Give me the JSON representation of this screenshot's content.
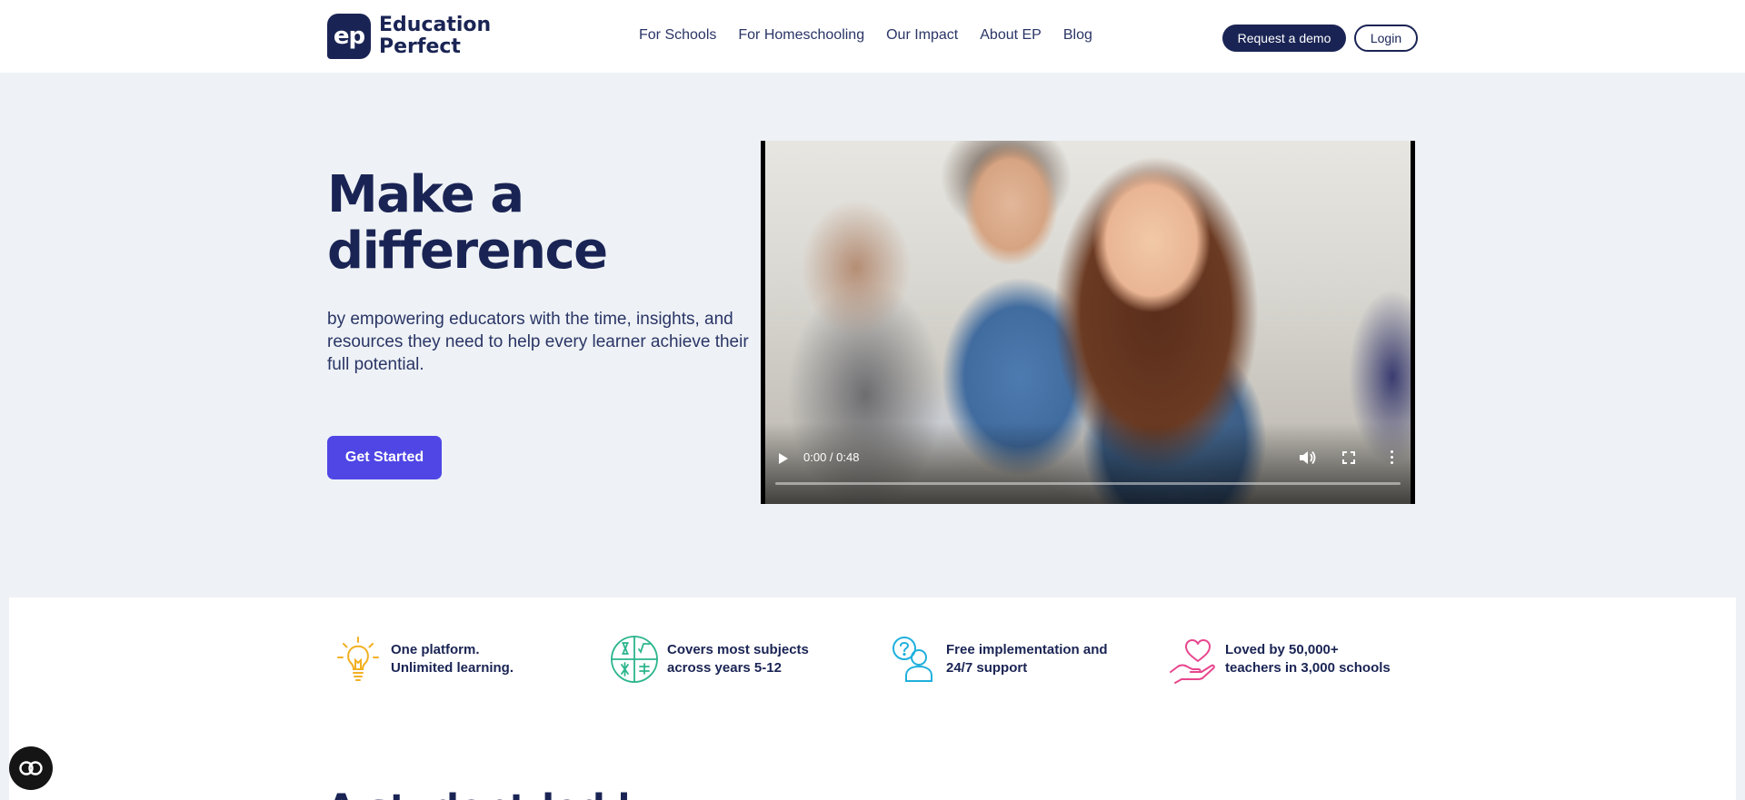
{
  "header": {
    "logo": {
      "mark": "ep",
      "line1": "Education",
      "line2": "Perfect"
    },
    "nav": [
      {
        "label": "For Schools"
      },
      {
        "label": "For Homeschooling"
      },
      {
        "label": "Our Impact"
      },
      {
        "label": "About EP"
      },
      {
        "label": "Blog"
      }
    ],
    "demo_label": "Request a demo",
    "login_label": "Login"
  },
  "hero": {
    "title_line1": "Make a",
    "title_line2": "difference",
    "subtitle": "by empowering educators with the time, insights, and resources they need to help every learner achieve their full potential.",
    "cta_label": "Get Started"
  },
  "video": {
    "time": "0:00 / 0:48",
    "controls": [
      "play-icon",
      "volume-icon",
      "fullscreen-icon",
      "more-options-icon"
    ]
  },
  "features": [
    {
      "icon": "lightbulb-icon",
      "line1": "One platform.",
      "line2": "Unlimited learning.",
      "color": "#f2b021"
    },
    {
      "icon": "subjects-icon",
      "line1": "Covers most subjects",
      "line2": "across years 5-12",
      "color": "#2bb58d"
    },
    {
      "icon": "support-icon",
      "line1": "Free implementation and",
      "line2": "24/7 support",
      "color": "#1fb0dd"
    },
    {
      "icon": "heart-hand-icon",
      "line1": "Loved by 50,000+",
      "line2": "teachers in 3,000 schools",
      "color": "#e8468e"
    }
  ],
  "section": {
    "heading_partial": "A student-led l"
  },
  "colors": {
    "navy": "#1a2454",
    "accent": "#4f46e5",
    "background": "#eef2f6"
  }
}
